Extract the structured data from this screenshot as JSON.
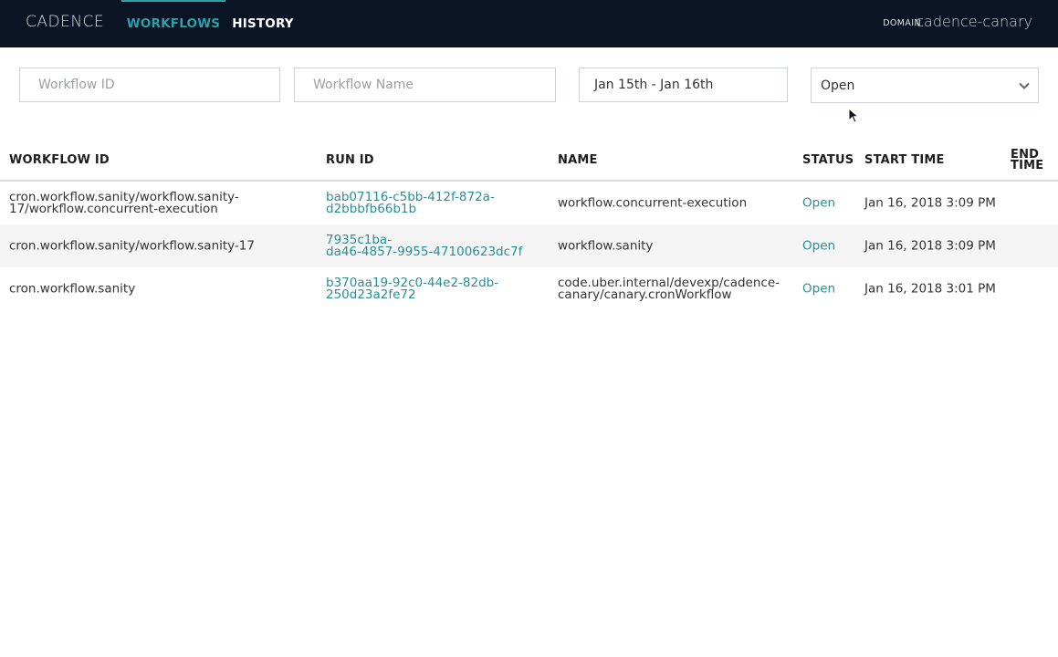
{
  "header": {
    "brand": "CADENCE",
    "tabs": [
      {
        "label": "WORKFLOWS",
        "active": true
      },
      {
        "label": "HISTORY",
        "active": false
      }
    ],
    "domain_label": "DOMAIN",
    "domain_value": "cadence-canary"
  },
  "filters": {
    "workflow_id_placeholder": "Workflow ID",
    "workflow_name_placeholder": "Workflow Name",
    "date_range": "Jan 15th - Jan 16th",
    "status_selected": "Open"
  },
  "table": {
    "columns": {
      "workflow_id": "WORKFLOW ID",
      "run_id": "RUN ID",
      "name": "NAME",
      "status": "STATUS",
      "start_time": "START TIME",
      "end_time_1": "END",
      "end_time_2": "TIME"
    },
    "rows": [
      {
        "workflow_id_1": "cron.workflow.sanity/workflow.sanity-",
        "workflow_id_2": "17/workflow.concurrent-execution",
        "run_id_1": "bab07116-c5bb-412f-872a-",
        "run_id_2": "d2bbbfb66b1b",
        "name_1": "workflow.concurrent-execution",
        "name_2": "",
        "status": "Open",
        "start_time": "Jan 16, 2018 3:09 PM"
      },
      {
        "workflow_id_1": "cron.workflow.sanity/workflow.sanity-17",
        "workflow_id_2": "",
        "run_id_1": "7935c1ba-",
        "run_id_2": "da46-4857-9955-47100623dc7f",
        "name_1": "workflow.sanity",
        "name_2": "",
        "status": "Open",
        "start_time": "Jan 16, 2018 3:09 PM"
      },
      {
        "workflow_id_1": "cron.workflow.sanity",
        "workflow_id_2": "",
        "run_id_1": "b370aa19-92c0-44e2-82db-",
        "run_id_2": "250d23a2fe72",
        "name_1": "code.uber.internal/devexp/cadence-",
        "name_2": "canary/canary.cronWorkflow",
        "status": "Open",
        "start_time": "Jan 16, 2018 3:01 PM"
      }
    ]
  },
  "colors": {
    "header_bg": "#0b1424",
    "accent": "#2aa1a7",
    "link": "#2a8f95",
    "row_alt": "#f5f5f5"
  },
  "icons": {
    "status_dropdown": "chevron-down-icon",
    "pointer": "mouse-cursor-icon"
  }
}
